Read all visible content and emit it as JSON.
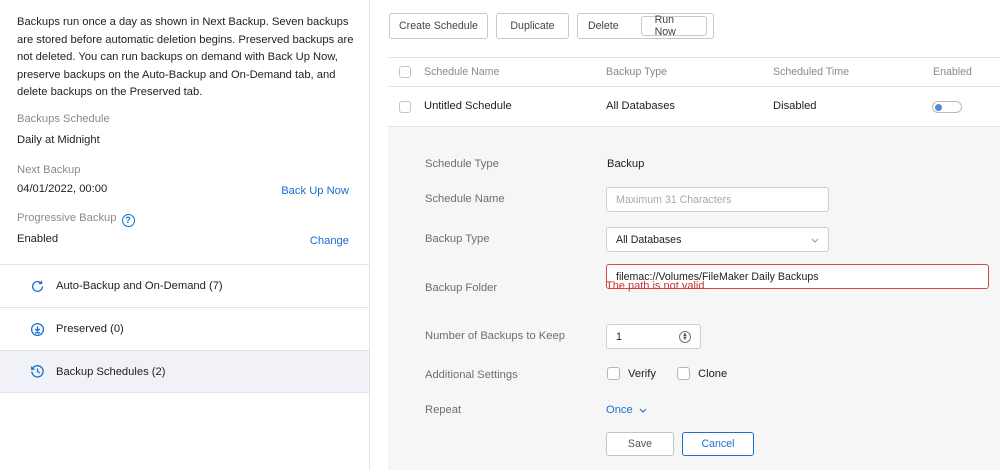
{
  "left": {
    "intro": "Backups run once a day as shown in Next Backup. Seven backups are stored before automatic deletion begins. Preserved backups are not deleted. You can run backups on demand with Back Up Now, preserve backups on the Auto-Backup and On-Demand tab, and delete backups on the Preserved tab.",
    "backups_schedule_label": "Backups Schedule",
    "backups_schedule_value": "Daily at Midnight",
    "next_backup_label": "Next Backup",
    "next_backup_value": "04/01/2022, 00:00",
    "back_up_now": "Back Up Now",
    "progressive_backup_label": "Progressive Backup",
    "help_glyph": "?",
    "progressive_backup_value": "Enabled",
    "change": "Change",
    "nav": [
      {
        "label": "Auto-Backup and On-Demand (7)",
        "icon": "refresh-icon"
      },
      {
        "label": "Preserved (0)",
        "icon": "preserved-icon"
      },
      {
        "label": "Backup Schedules (2)",
        "icon": "history-clock-icon",
        "active": true
      }
    ]
  },
  "toolbar": {
    "create_schedule": "Create Schedule",
    "duplicate": "Duplicate",
    "delete": "Delete",
    "run_now": "Run Now"
  },
  "table": {
    "headers": [
      "Schedule Name",
      "Backup Type",
      "Scheduled Time",
      "Enabled"
    ],
    "row": {
      "name": "Untitled Schedule",
      "type": "All Databases",
      "time": "Disabled",
      "enabled": false
    }
  },
  "detail": {
    "schedule_type_label": "Schedule Type",
    "schedule_type_value": "Backup",
    "schedule_name_label": "Schedule Name",
    "schedule_name_placeholder": "Maximum 31 Characters",
    "backup_type_label": "Backup Type",
    "backup_type_value": "All Databases",
    "backup_folder_label": "Backup Folder",
    "backup_folder_value": "filemac://Volumes/FileMaker Daily Backups",
    "backup_folder_error": "The path is not valid.",
    "keep_label": "Number of Backups to Keep",
    "keep_value": "1",
    "additional_label": "Additional Settings",
    "verify": "Verify",
    "clone": "Clone",
    "repeat_label": "Repeat",
    "repeat_value": "Once",
    "save": "Save",
    "cancel": "Cancel"
  },
  "colors": {
    "accent": "#1a6fd1",
    "error": "#cc2f2f",
    "active_nav_bg": "#f1f2f8",
    "detail_bg": "#f6f6f6"
  }
}
